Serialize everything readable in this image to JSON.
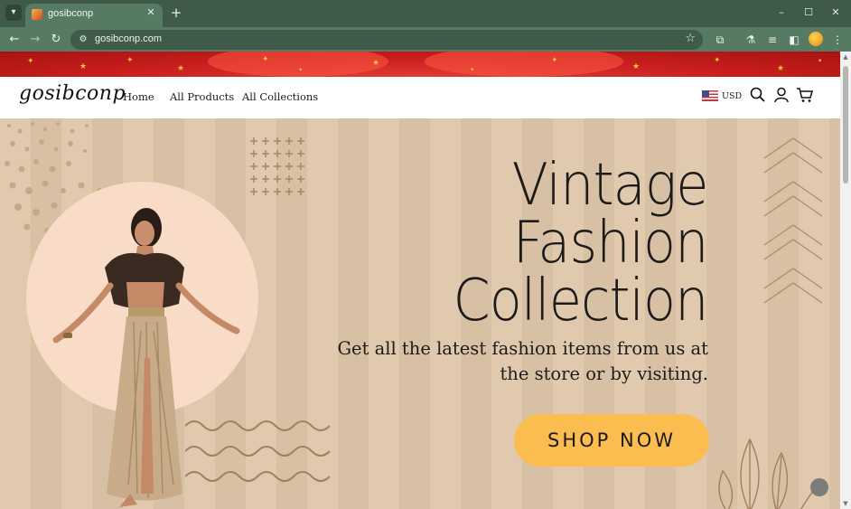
{
  "browser": {
    "tab": {
      "title": "gosibconp"
    },
    "url": "gosibconp.com",
    "window_controls": [
      "–",
      "☐",
      "✕"
    ],
    "colors": {
      "frame": "#3f5a48",
      "toolbar": "#567a62"
    }
  },
  "header": {
    "logo": "gosibconp",
    "nav": [
      "Home",
      "All Products",
      "All Collections"
    ],
    "currency": "USD"
  },
  "hero": {
    "title_lines": [
      "Vintage",
      "Fashion",
      "Collection"
    ],
    "subtitle": "Get all the latest fashion items from us at the store or by visiting.",
    "cta_label": "SHOP NOW",
    "colors": {
      "background": "#dfc6aa",
      "circle": "#f8dcc7",
      "button": "#fbbd50",
      "banner": "#c81e1e"
    }
  },
  "icons": [
    "search-icon",
    "user-icon",
    "cart-icon",
    "star-icon",
    "extensions-icon",
    "labs-icon",
    "reading-list-icon",
    "sidebar-icon",
    "menu-icon",
    "back-icon",
    "forward-icon",
    "reload-icon"
  ]
}
